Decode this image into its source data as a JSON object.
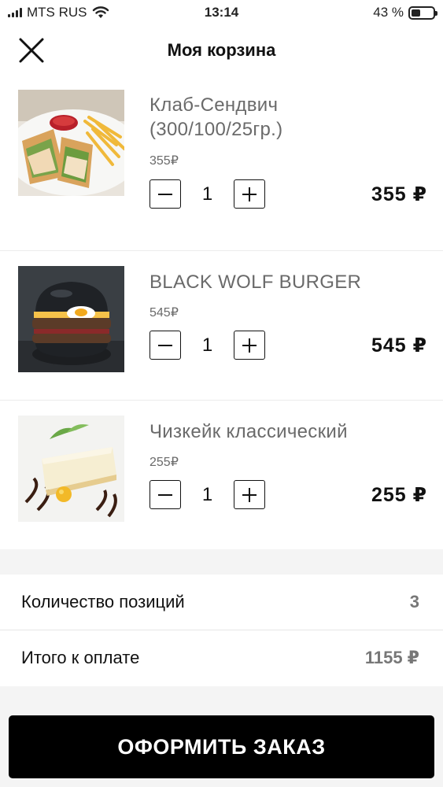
{
  "status_bar": {
    "carrier": "MTS RUS",
    "time": "13:14",
    "battery": "43 %",
    "battery_level": 0.43
  },
  "header": {
    "title": "Моя корзина"
  },
  "cart": {
    "items": [
      {
        "name_line1": "Клаб-Сендвич",
        "name_line2": "(300/100/25гр.)",
        "old_price": "355₽",
        "quantity": "1",
        "price": "355 ₽",
        "image": "club-sandwich-photo"
      },
      {
        "name_line1": "BLACK WOLF BURGER",
        "old_price": "545₽",
        "quantity": "1",
        "price": "545 ₽",
        "image": "black-burger-photo"
      },
      {
        "name_line1": "Чизкейк классический",
        "old_price": "255₽",
        "quantity": "1",
        "price": "255 ₽",
        "image": "cheesecake-photo"
      }
    ]
  },
  "summary": {
    "count_label": "Количество позиций",
    "count_value": "3",
    "total_label": "Итого к оплате",
    "total_value": "1155 ₽"
  },
  "checkout": {
    "label": "ОФОРМИТЬ ЗАКАЗ"
  },
  "icons": {
    "close": "close-icon",
    "minus": "minus-icon",
    "plus": "plus-icon",
    "signal": "cellular-signal-icon",
    "wifi": "wifi-icon",
    "battery": "battery-icon"
  }
}
